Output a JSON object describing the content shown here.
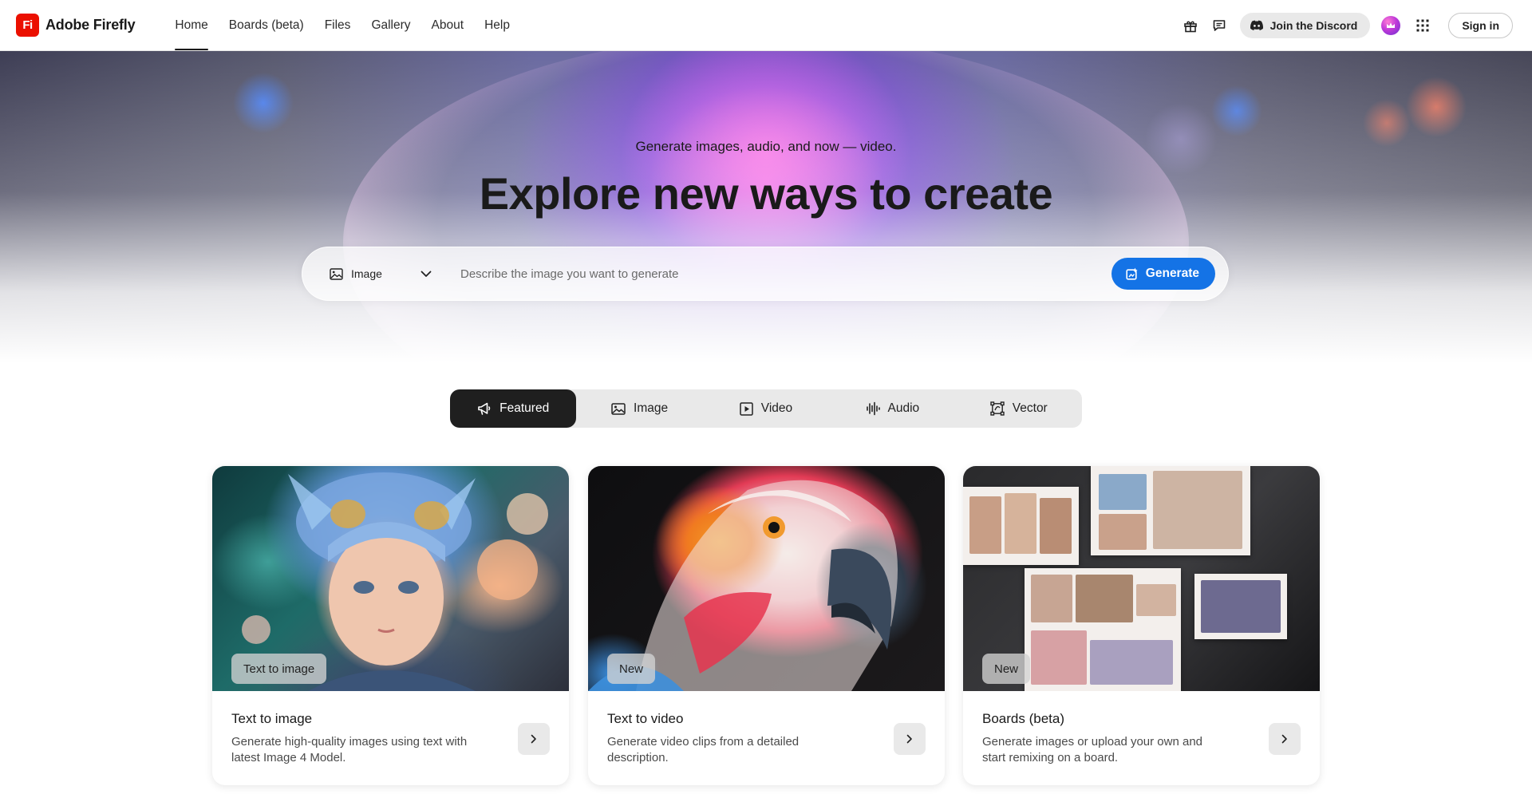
{
  "brand": {
    "logo_text": "Fi",
    "name": "Adobe Firefly",
    "logo_color": "#eb1000"
  },
  "nav": {
    "items": [
      {
        "label": "Home",
        "active": true
      },
      {
        "label": "Boards (beta)"
      },
      {
        "label": "Files"
      },
      {
        "label": "Gallery"
      },
      {
        "label": "About"
      },
      {
        "label": "Help"
      }
    ]
  },
  "topbar": {
    "icons": [
      "gift-icon",
      "chat-icon"
    ],
    "discord_label": "Join the Discord",
    "signin_label": "Sign in"
  },
  "hero": {
    "subtitle": "Generate images, audio, and now — video.",
    "title": "Explore new ways to create",
    "prompt": {
      "type_label": "Image",
      "placeholder": "Describe the image you want to generate",
      "value": "",
      "generate_label": "Generate"
    }
  },
  "tabs": [
    {
      "label": "Featured",
      "icon": "megaphone-icon",
      "active": true
    },
    {
      "label": "Image",
      "icon": "image-icon"
    },
    {
      "label": "Video",
      "icon": "video-icon"
    },
    {
      "label": "Audio",
      "icon": "audio-icon"
    },
    {
      "label": "Vector",
      "icon": "vector-icon"
    }
  ],
  "cards": [
    {
      "badge": "Text to image",
      "title": "Text to image",
      "description": "Generate high-quality images using text with latest Image 4 Model."
    },
    {
      "badge": "New",
      "title": "Text to video",
      "description": "Generate video clips from a detailed description."
    },
    {
      "badge": "New",
      "title": "Boards (beta)",
      "description": "Generate images or upload your own and start remixing on a board."
    }
  ],
  "colors": {
    "accent": "#1473e6",
    "active_tab": "#1f1f1f",
    "tab_bg": "#e9e9e9"
  }
}
